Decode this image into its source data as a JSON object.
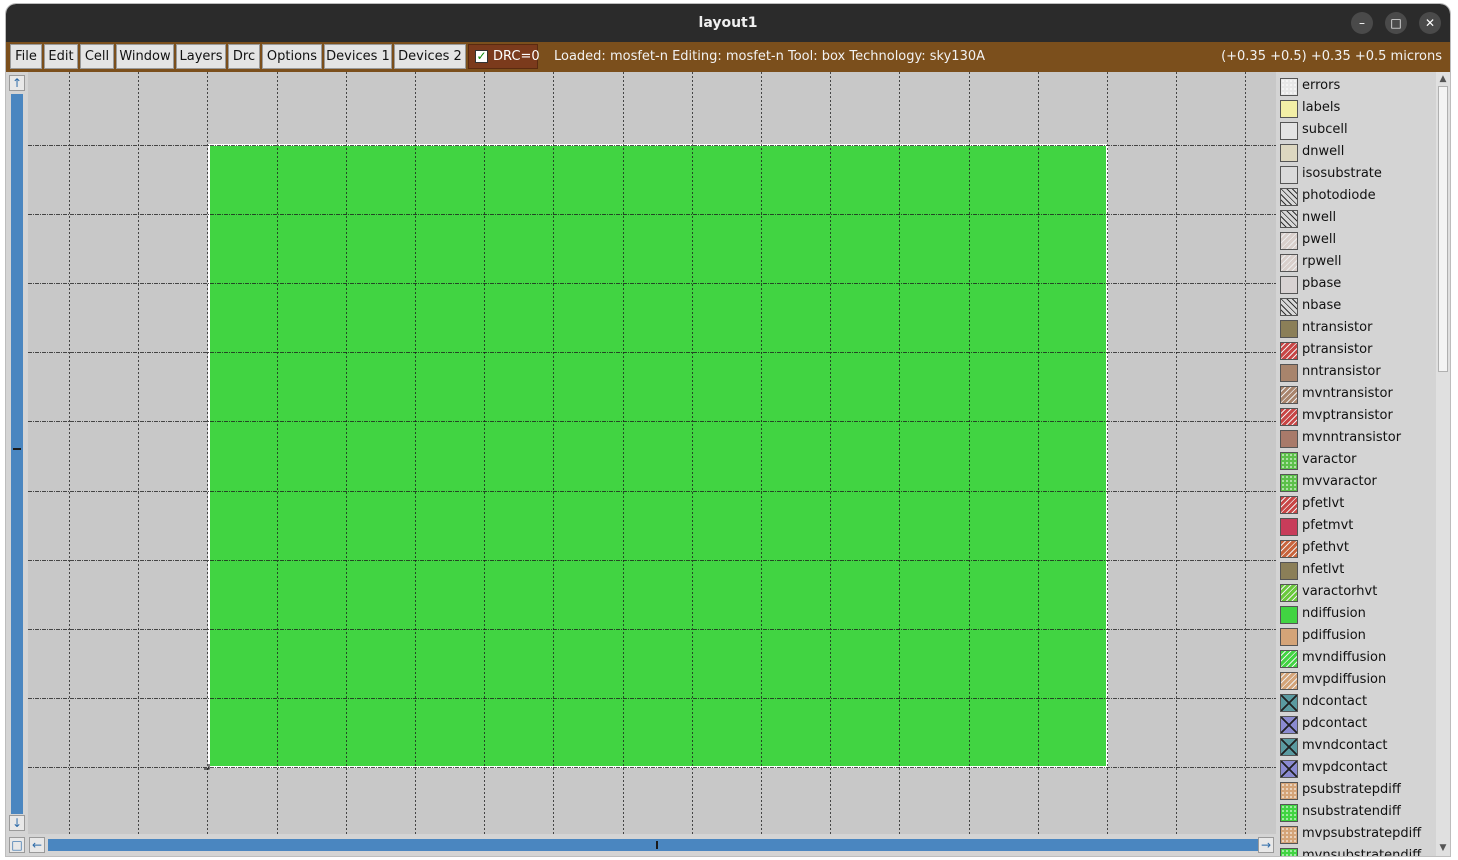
{
  "window": {
    "title": "layout1",
    "controls": {
      "minimize": "–",
      "maximize": "□",
      "close": "✕"
    }
  },
  "menubar": {
    "items": [
      "File",
      "Edit",
      "Cell",
      "Window",
      "Layers",
      "Drc",
      "Options",
      "Devices 1",
      "Devices 2"
    ],
    "drc": {
      "checked": true,
      "label": "DRC=0"
    },
    "status": "Loaded: mosfet-n Editing: mosfet-n Tool: box  Technology: sky130A",
    "coordinates": "(+0.35 +0.5) +0.35 +0.5 microns"
  },
  "scrollbars": {
    "up_icon": "↑",
    "down_icon": "↓",
    "left_icon": "←",
    "right_icon": "→",
    "corner_icon": "□"
  },
  "canvas": {
    "background_color": "#c8c8c8",
    "grid_color": "#1a1a1a",
    "ndiffusion_color": "#41d442",
    "selection_outline_color": "#ffffff"
  },
  "layers": [
    {
      "name": "errors",
      "color": "#e8e8e8",
      "pattern": "dots"
    },
    {
      "name": "labels",
      "color": "#f3efa6",
      "pattern": "plain"
    },
    {
      "name": "subcell",
      "color": "#e4e4e4",
      "pattern": "plain"
    },
    {
      "name": "dnwell",
      "color": "#ddd7c0",
      "pattern": "plain"
    },
    {
      "name": "isosubstrate",
      "color": "#dadada",
      "pattern": "plain"
    },
    {
      "name": "photodiode",
      "color": "#d8d8d8",
      "pattern": "hatch"
    },
    {
      "name": "nwell",
      "color": "#d8d8d8",
      "pattern": "hatch"
    },
    {
      "name": "pwell",
      "color": "#d9cfcb",
      "pattern": "fwd"
    },
    {
      "name": "rpwell",
      "color": "#d9cfcb",
      "pattern": "fwd"
    },
    {
      "name": "pbase",
      "color": "#d8d2d2",
      "pattern": "plain"
    },
    {
      "name": "nbase",
      "color": "#d8d8d8",
      "pattern": "hatch"
    },
    {
      "name": "ntransistor",
      "color": "#8b7f58",
      "pattern": "plain"
    },
    {
      "name": "ptransistor",
      "color": "#c84646",
      "pattern": "fwd"
    },
    {
      "name": "nntransistor",
      "color": "#a8846c",
      "pattern": "plain"
    },
    {
      "name": "mvntransistor",
      "color": "#a8846c",
      "pattern": "fwd"
    },
    {
      "name": "mvptransistor",
      "color": "#c84646",
      "pattern": "fwd"
    },
    {
      "name": "mvnntransistor",
      "color": "#a87a6a",
      "pattern": "plain"
    },
    {
      "name": "varactor",
      "color": "#5cc04a",
      "pattern": "dots"
    },
    {
      "name": "mvvaractor",
      "color": "#5cc04a",
      "pattern": "dots"
    },
    {
      "name": "pfetlvt",
      "color": "#c84646",
      "pattern": "fwd"
    },
    {
      "name": "pfetmvt",
      "color": "#c83c5a",
      "pattern": "plain"
    },
    {
      "name": "pfethvt",
      "color": "#c8643c",
      "pattern": "fwd"
    },
    {
      "name": "nfetlvt",
      "color": "#8b7f58",
      "pattern": "plain"
    },
    {
      "name": "varactorhvt",
      "color": "#6ac83c",
      "pattern": "fwd"
    },
    {
      "name": "ndiffusion",
      "color": "#41d442",
      "pattern": "plain"
    },
    {
      "name": "pdiffusion",
      "color": "#d4a478",
      "pattern": "plain"
    },
    {
      "name": "mvndiffusion",
      "color": "#41d442",
      "pattern": "fwd"
    },
    {
      "name": "mvpdiffusion",
      "color": "#d4a478",
      "pattern": "fwd"
    },
    {
      "name": "ndcontact",
      "color": "#5a9aa0",
      "pattern": "cross"
    },
    {
      "name": "pdcontact",
      "color": "#8a8ad0",
      "pattern": "cross"
    },
    {
      "name": "mvndcontact",
      "color": "#5a9aa0",
      "pattern": "cross"
    },
    {
      "name": "mvpdcontact",
      "color": "#8a8ad0",
      "pattern": "cross"
    },
    {
      "name": "psubstratepdiff",
      "color": "#d4a478",
      "pattern": "dots"
    },
    {
      "name": "nsubstratendiff",
      "color": "#41d442",
      "pattern": "dots"
    },
    {
      "name": "mvpsubstratepdiff",
      "color": "#d4a478",
      "pattern": "dots"
    },
    {
      "name": "mvnsubstratendiff",
      "color": "#41d442",
      "pattern": "dots"
    }
  ]
}
